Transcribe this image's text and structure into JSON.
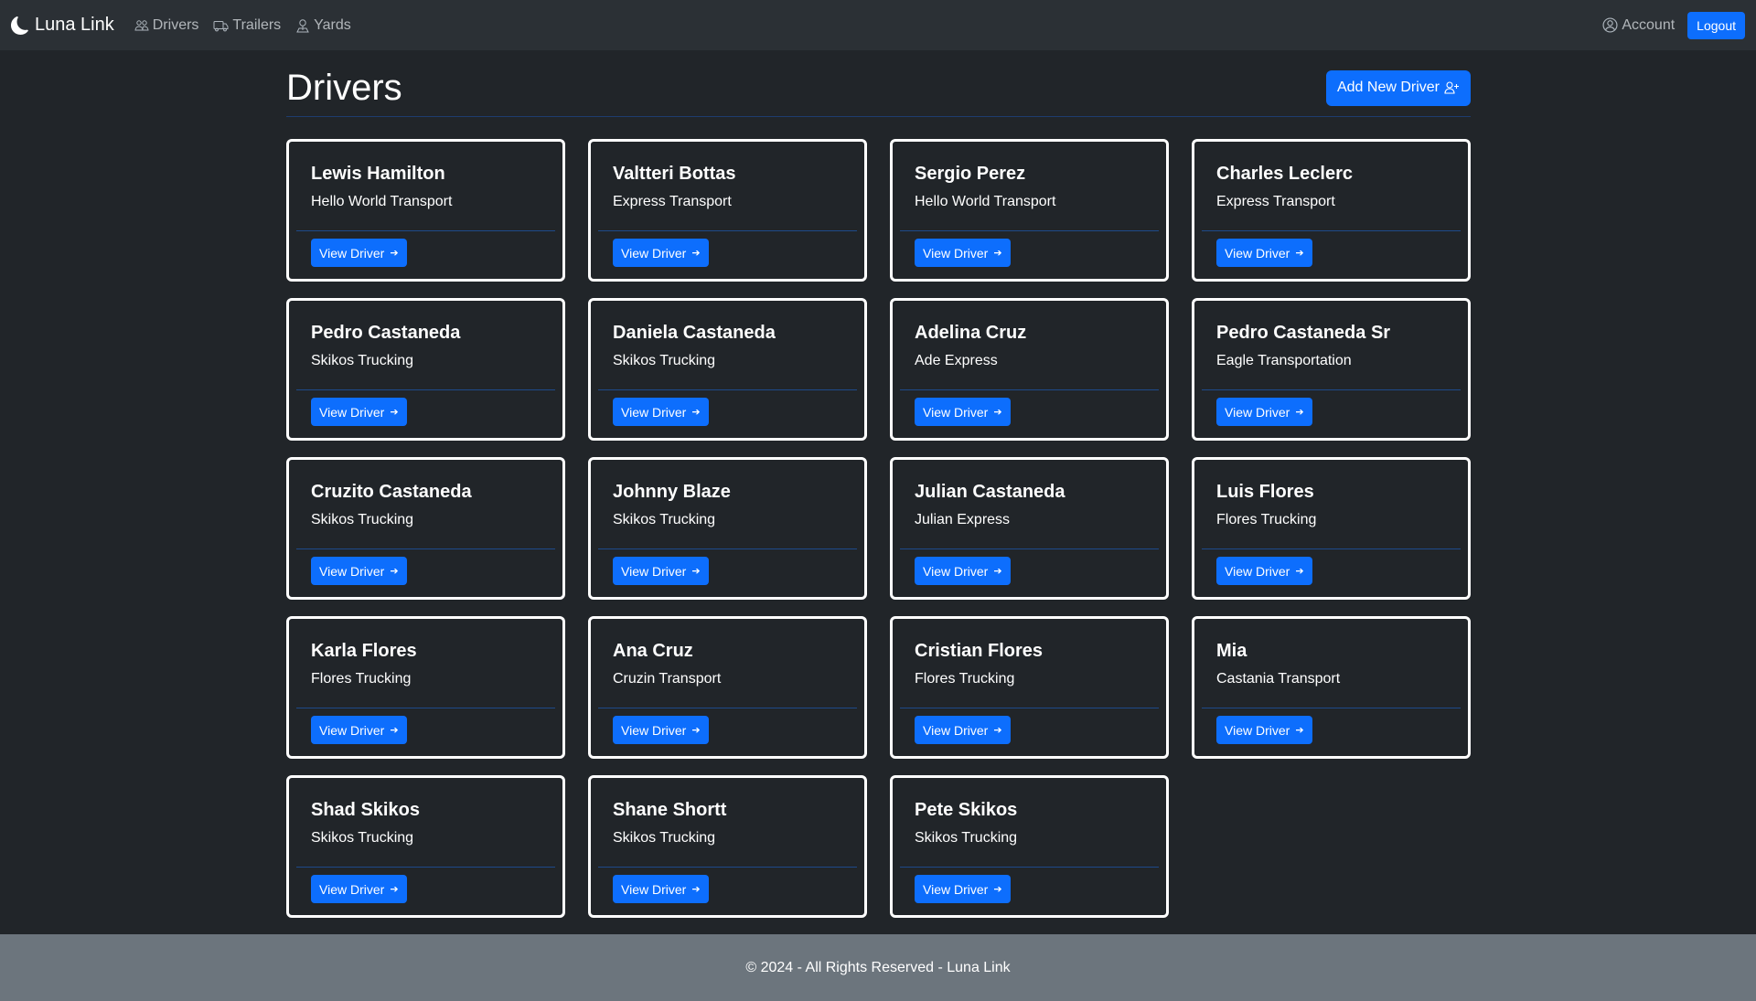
{
  "navbar": {
    "brand": "Luna Link",
    "links": [
      {
        "label": "Drivers",
        "icon": "people-icon"
      },
      {
        "label": "Trailers",
        "icon": "truck-icon"
      },
      {
        "label": "Yards",
        "icon": "map-pin-icon"
      }
    ],
    "account_label": "Account",
    "logout_label": "Logout"
  },
  "page": {
    "title": "Drivers",
    "add_button_label": "Add New Driver"
  },
  "drivers": [
    {
      "name": "Lewis Hamilton",
      "company": "Hello World Transport",
      "button": "View Driver"
    },
    {
      "name": "Valtteri Bottas",
      "company": "Express Transport",
      "button": "View Driver"
    },
    {
      "name": "Sergio Perez",
      "company": "Hello World Transport",
      "button": "View Driver"
    },
    {
      "name": "Charles Leclerc",
      "company": "Express Transport",
      "button": "View Driver"
    },
    {
      "name": "Pedro Castaneda",
      "company": "Skikos Trucking",
      "button": "View Driver"
    },
    {
      "name": "Daniela Castaneda",
      "company": "Skikos Trucking",
      "button": "View Driver"
    },
    {
      "name": "Adelina Cruz",
      "company": "Ade Express",
      "button": "View Driver"
    },
    {
      "name": "Pedro Castaneda Sr",
      "company": "Eagle Transportation",
      "button": "View Driver"
    },
    {
      "name": "Cruzito Castaneda",
      "company": "Skikos Trucking",
      "button": "View Driver"
    },
    {
      "name": "Johnny Blaze",
      "company": "Skikos Trucking",
      "button": "View Driver"
    },
    {
      "name": "Julian Castaneda",
      "company": "Julian Express",
      "button": "View Driver"
    },
    {
      "name": "Luis Flores",
      "company": "Flores Trucking",
      "button": "View Driver"
    },
    {
      "name": "Karla Flores",
      "company": "Flores Trucking",
      "button": "View Driver"
    },
    {
      "name": "Ana Cruz",
      "company": "Cruzin Transport",
      "button": "View Driver"
    },
    {
      "name": "Cristian Flores",
      "company": "Flores Trucking",
      "button": "View Driver"
    },
    {
      "name": "Mia",
      "company": "Castania Transport",
      "button": "View Driver"
    },
    {
      "name": "Shad Skikos",
      "company": "Skikos Trucking",
      "button": "View Driver"
    },
    {
      "name": "Shane Shortt",
      "company": "Skikos Trucking",
      "button": "View Driver"
    },
    {
      "name": "Pete Skikos",
      "company": "Skikos Trucking",
      "button": "View Driver"
    }
  ],
  "footer": {
    "text": "© 2024 - All Rights Reserved - Luna Link"
  },
  "colors": {
    "primary": "#0d6efd",
    "navbar_bg": "#2b3035",
    "page_bg": "#212529",
    "footer_bg": "#6c757d"
  }
}
